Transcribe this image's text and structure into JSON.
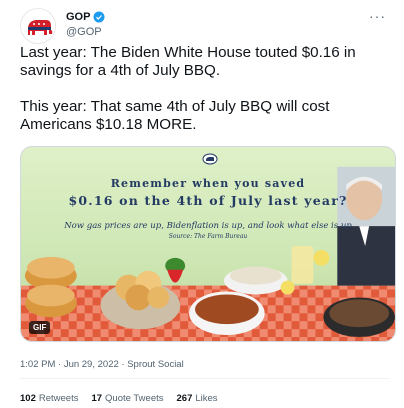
{
  "tweet": {
    "display_name": "GOP",
    "handle": "@GOP",
    "more_icon": "more-icon",
    "text": "Last year: The Biden White House touted $0.16 in savings for a 4th of July BBQ.\n\nThis year: That same 4th of July BBQ will cost Americans $10.18 MORE.",
    "timestamp": "1:02 PM · Jun 29, 2022 · Sprout Social"
  },
  "media": {
    "headline_line1": "Remember when you saved",
    "headline_line2": "$0.16 on the 4th of July last year?",
    "subline": "Now gas prices are up, Bidenflation is up, and look what else is up",
    "source": "Source: The Farm Bureau",
    "badge": "GIF"
  },
  "stats": {
    "retweets_count": "102",
    "retweets_label": "Retweets",
    "quotes_count": "17",
    "quotes_label": "Quote Tweets",
    "likes_count": "267",
    "likes_label": "Likes"
  },
  "colors": {
    "brand_red": "#d21f2a",
    "verified_blue": "#1d9bf0",
    "text_primary": "#0f1419",
    "text_secondary": "#536471"
  }
}
